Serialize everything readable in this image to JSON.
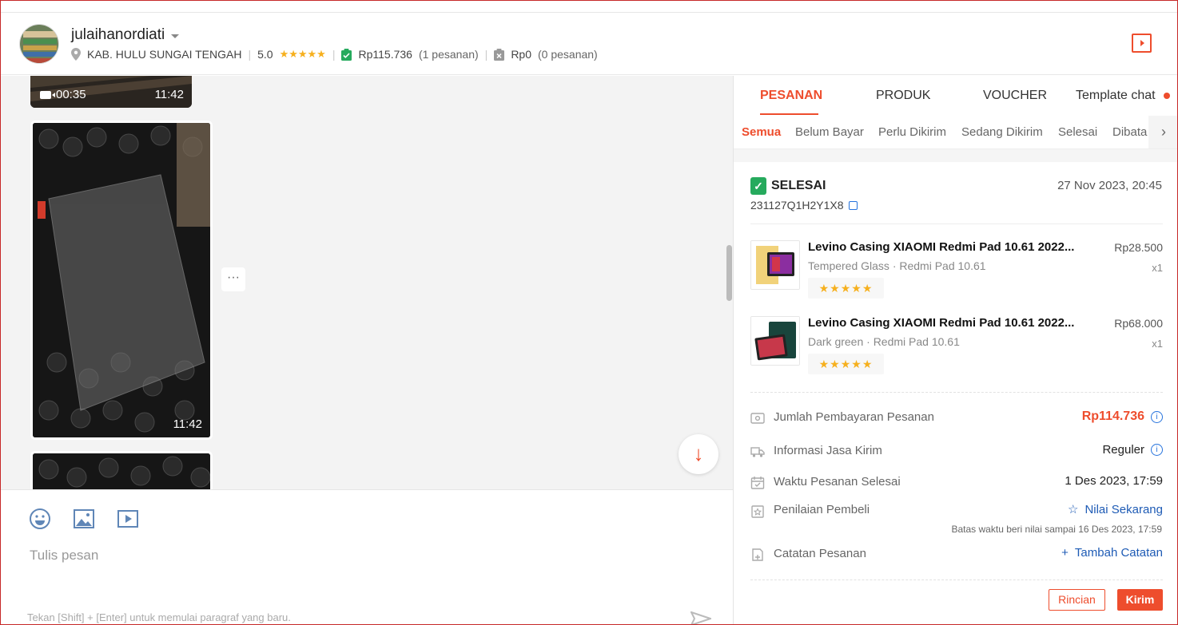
{
  "header": {
    "username": "julaihanordiati",
    "location": "KAB. HULU SUNGAI TENGAH",
    "rating": "5.0",
    "rating_stars": "★★★★★",
    "total_paid": "Rp115.736",
    "total_paid_count": "(1 pesanan)",
    "cancelled_amount": "Rp0",
    "cancelled_count": "(0 pesanan)"
  },
  "chat": {
    "messages": [
      {
        "type": "video",
        "duration": "00:35",
        "time": "11:42"
      },
      {
        "type": "image",
        "time": "11:42"
      },
      {
        "type": "image",
        "time": ""
      }
    ],
    "more_label": "···",
    "scroll_down_label": "↓"
  },
  "composer": {
    "placeholder": "Tulis pesan",
    "hint": "Tekan [Shift] + [Enter] untuk memulai paragraf yang baru."
  },
  "panel": {
    "tabs": [
      {
        "label": "PESANAN",
        "active": true
      },
      {
        "label": "PRODUK",
        "active": false
      },
      {
        "label": "VOUCHER",
        "active": false
      },
      {
        "label": "Template chat",
        "active": false
      }
    ],
    "subtabs": [
      {
        "label": "Semua",
        "active": true
      },
      {
        "label": "Belum Bayar",
        "active": false
      },
      {
        "label": "Perlu Dikirim",
        "active": false
      },
      {
        "label": "Sedang Dikirim",
        "active": false
      },
      {
        "label": "Selesai",
        "active": false
      },
      {
        "label": "Dibata",
        "active": false
      }
    ],
    "order": {
      "status": "SELESAI",
      "date": "27 Nov 2023, 20:45",
      "id": "231127Q1H2Y1X8",
      "products": [
        {
          "name": "Levino Casing XIAOMI Redmi Pad 10.61 2022...",
          "variant": "Tempered Glass · Redmi Pad 10.61",
          "price": "Rp28.500",
          "qty": "x1",
          "stars": "★★★★★"
        },
        {
          "name": "Levino Casing XIAOMI Redmi Pad 10.61 2022...",
          "variant": "Dark green · Redmi Pad 10.61",
          "price": "Rp68.000",
          "qty": "x1",
          "stars": "★★★★★"
        }
      ],
      "payment_label": "Jumlah Pembayaran Pesanan",
      "payment_value": "Rp114.736",
      "shipping_label": "Informasi Jasa Kirim",
      "shipping_value": "Reguler",
      "completed_label": "Waktu Pesanan Selesai",
      "completed_value": "1 Des 2023, 17:59",
      "review_label": "Penilaian Pembeli",
      "review_action": "Nilai Sekarang",
      "review_deadline": "Batas waktu beri nilai sampai 16 Des 2023, 17:59",
      "notes_label": "Catatan Pesanan",
      "notes_action": "Tambah Catatan",
      "details_button": "Rincian",
      "send_button": "Kirim"
    }
  },
  "colors": {
    "accent": "#ee4d2d",
    "success": "#26aa5d",
    "link": "#1e5bb5",
    "star": "#f6b01e"
  }
}
